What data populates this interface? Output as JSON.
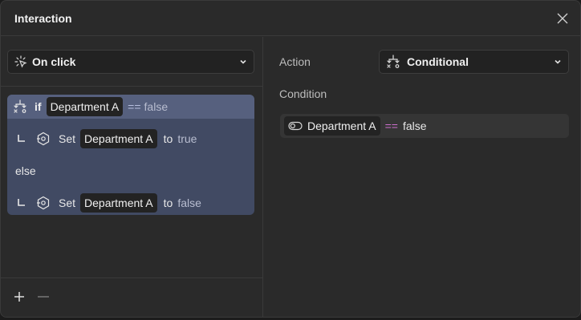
{
  "dialog": {
    "title": "Interaction"
  },
  "trigger": {
    "label": "On click"
  },
  "logic": {
    "if_keyword": "if",
    "if_variable": "Department A",
    "if_operator": "==",
    "if_value": "false",
    "set1": {
      "keyword": "Set",
      "variable": "Department A",
      "to": "to",
      "value": "true"
    },
    "else_keyword": "else",
    "set2": {
      "keyword": "Set",
      "variable": "Department A",
      "to": "to",
      "value": "false"
    }
  },
  "action": {
    "label": "Action",
    "selected": "Conditional"
  },
  "condition": {
    "label": "Condition",
    "variable": "Department A",
    "operator": "==",
    "value": "false"
  },
  "icons": {
    "close": "close-icon",
    "trigger": "click-icon",
    "conditional": "conditional-icon",
    "set": "set-variable-icon",
    "toggle": "toggle-icon",
    "add": "plus-icon",
    "remove": "minus-icon",
    "chevron": "chevron-down-icon"
  }
}
